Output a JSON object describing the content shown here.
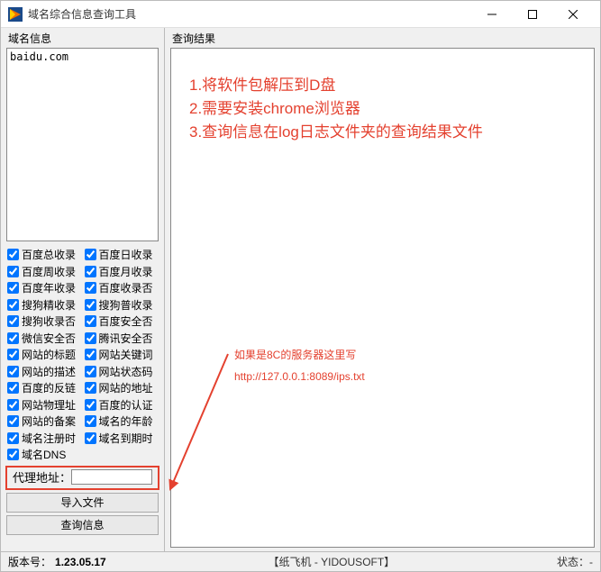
{
  "window": {
    "title": "域名综合信息查询工具"
  },
  "left": {
    "group_label": "域名信息",
    "textarea_value": "baidu.com",
    "checkboxes": [
      {
        "label": "百度总收录",
        "checked": true
      },
      {
        "label": "百度日收录",
        "checked": true
      },
      {
        "label": "百度周收录",
        "checked": true
      },
      {
        "label": "百度月收录",
        "checked": true
      },
      {
        "label": "百度年收录",
        "checked": true
      },
      {
        "label": "百度收录否",
        "checked": true
      },
      {
        "label": "搜狗精收录",
        "checked": true
      },
      {
        "label": "搜狗普收录",
        "checked": true
      },
      {
        "label": "搜狗收录否",
        "checked": true
      },
      {
        "label": "百度安全否",
        "checked": true
      },
      {
        "label": "微信安全否",
        "checked": true
      },
      {
        "label": "腾讯安全否",
        "checked": true
      },
      {
        "label": "网站的标题",
        "checked": true
      },
      {
        "label": "网站关键词",
        "checked": true
      },
      {
        "label": "网站的描述",
        "checked": true
      },
      {
        "label": "网站状态码",
        "checked": true
      },
      {
        "label": "百度的反链",
        "checked": true
      },
      {
        "label": "网站的地址",
        "checked": true
      },
      {
        "label": "网站物理址",
        "checked": true
      },
      {
        "label": "百度的认证",
        "checked": true
      },
      {
        "label": "网站的备案",
        "checked": true
      },
      {
        "label": "域名的年龄",
        "checked": true
      },
      {
        "label": "域名注册时",
        "checked": true
      },
      {
        "label": "域名到期时",
        "checked": true
      },
      {
        "label": "域名DNS",
        "checked": true
      }
    ],
    "proxy_label": "代理地址：",
    "proxy_value": "",
    "btn_import": "导入文件",
    "btn_query": "查询信息"
  },
  "right": {
    "group_label": "查询结果",
    "annotation_top": "1.将软件包解压到D盘\n2.需要安装chrome浏览器\n3.查询信息在log日志文件夹的查询结果文件",
    "annotation_side_line1": "如果是8C的服务器这里写",
    "annotation_side_line2": "http://127.0.0.1:8089/ips.txt"
  },
  "statusbar": {
    "version_label": "版本号：",
    "version_value": "1.23.05.17",
    "center_text": "【纸飞机 - YIDOUSOFT】",
    "state_label": "状态：",
    "state_value": "-"
  },
  "colors": {
    "annotation": "#e4412f"
  }
}
